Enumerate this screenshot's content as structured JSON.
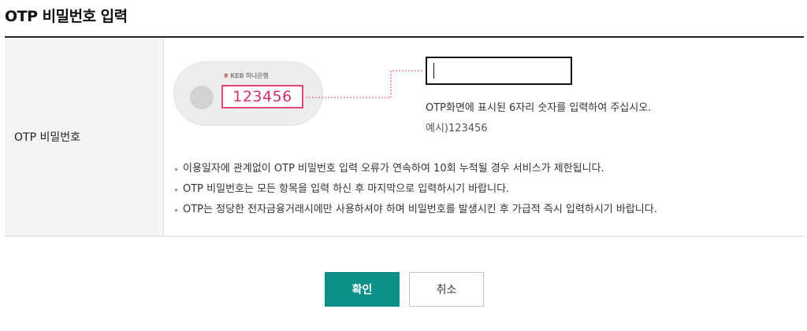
{
  "page": {
    "title": "OTP 비밀번호 입력"
  },
  "form": {
    "row_label": "OTP 비밀번호",
    "otp_input_value": "",
    "otp_input_placeholder": ""
  },
  "device": {
    "brand": "KEB 하나은행",
    "screen_number": "123456",
    "accent_color": "#e0457b"
  },
  "guide": {
    "instruction": "OTP화면에 표시된 6자리 숫자를 입력하여 주십시오.",
    "example": "예시)123456"
  },
  "notes": [
    "이용일자에 관계없이 OTP 비밀번호 입력 오류가 연속하여 10회 누적될 경우 서비스가 제한됩니다.",
    "OTP 비밀번호는 모든 항목을 입력 하신 후 마지막으로 입력하시기 바랍니다.",
    "OTP는 정당한 전자금융거래시에만 사용하셔야 하며 비밀번호를 발생시킨 후 가급적 즉시 입력하시기 바랍니다."
  ],
  "buttons": {
    "confirm_label": "확인",
    "cancel_label": "취소",
    "confirm_color": "#0c8f86"
  }
}
